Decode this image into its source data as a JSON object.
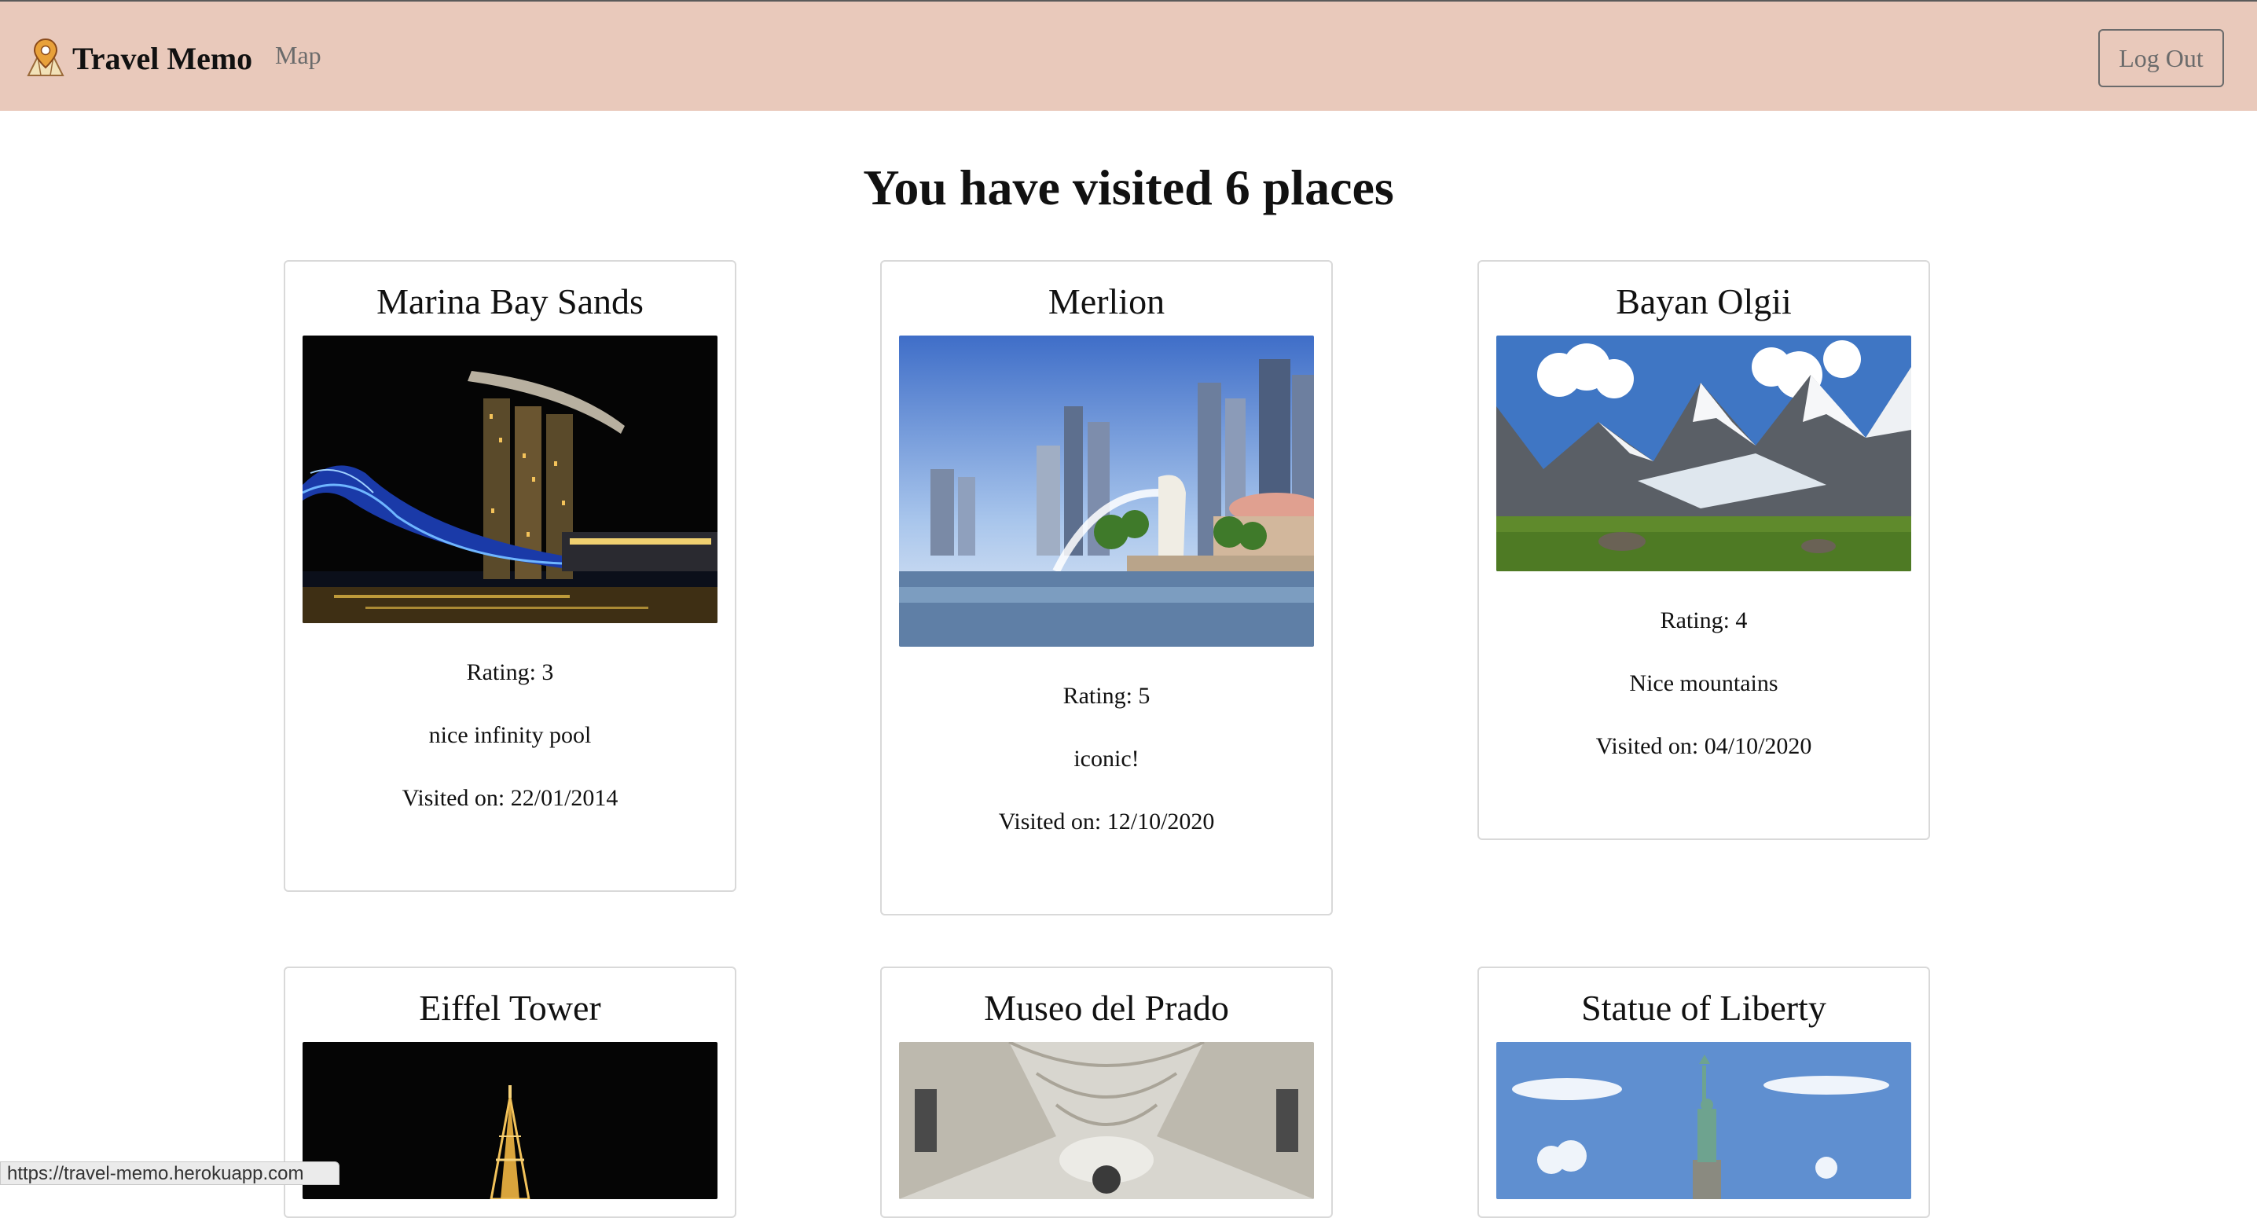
{
  "navbar": {
    "brand": "Travel Memo",
    "map_link": "Map",
    "logout": "Log Out",
    "background": "#e9c9bb"
  },
  "heading": "You have visited 6 places",
  "places": [
    {
      "name": "Marina Bay Sands",
      "rating": "Rating: 3",
      "note": "nice infinity pool",
      "visited": "Visited on: 22/01/2014"
    },
    {
      "name": "Merlion",
      "rating": "Rating: 5",
      "note": "iconic!",
      "visited": "Visited on: 12/10/2020"
    },
    {
      "name": "Bayan Olgii",
      "rating": "Rating: 4",
      "note": "Nice mountains",
      "visited": "Visited on: 04/10/2020"
    },
    {
      "name": "Eiffel Tower"
    },
    {
      "name": "Museo del Prado"
    },
    {
      "name": "Statue of Liberty"
    }
  ],
  "status_url": "https://travel-memo.herokuapp.com"
}
